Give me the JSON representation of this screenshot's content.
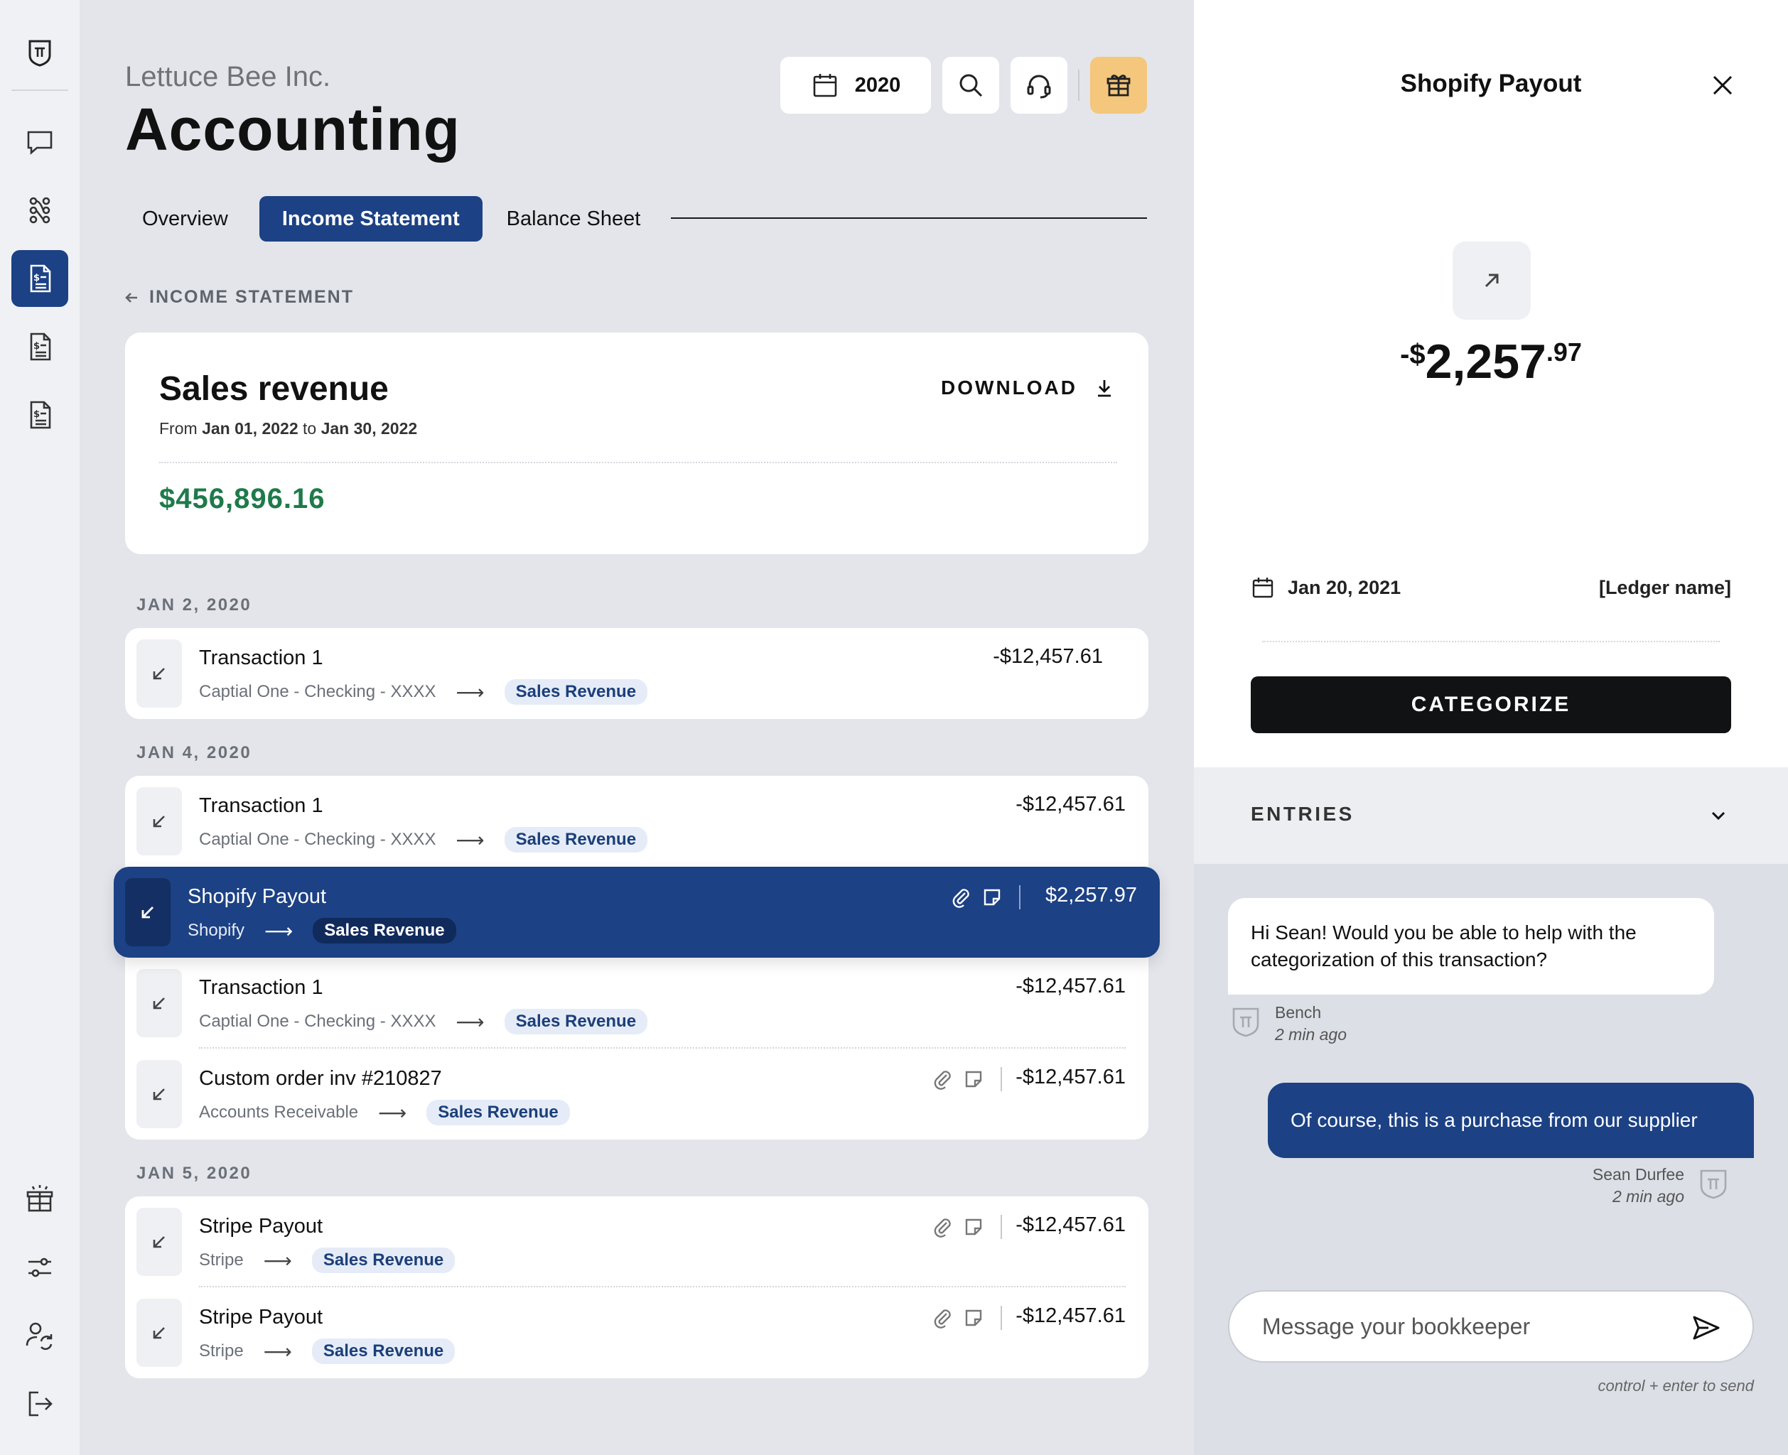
{
  "header": {
    "company": "Lettuce Bee Inc.",
    "title": "Accounting",
    "year": "2020"
  },
  "tabs": [
    {
      "label": "Overview",
      "active": false
    },
    {
      "label": "Income Statement",
      "active": true
    },
    {
      "label": "Balance Sheet",
      "active": false
    }
  ],
  "breadcrumb": "INCOME STATEMENT",
  "summary": {
    "title": "Sales revenue",
    "range_prefix": "From",
    "range_start": "Jan 01, 2022",
    "range_mid": "to",
    "range_end": "Jan 30, 2022",
    "download_label": "DOWNLOAD",
    "total": "$456,896.16"
  },
  "groups": [
    {
      "date": "JAN 2, 2020",
      "transactions": [
        {
          "name": "Transaction 1",
          "source": "Captial One - Checking - XXXX",
          "category": "Sales Revenue",
          "amount": "-$12,457.61"
        }
      ]
    },
    {
      "date": "JAN 4, 2020",
      "transactions": [
        {
          "name": "Transaction 1",
          "source": "Captial One - Checking - XXXX",
          "category": "Sales Revenue",
          "amount": "-$12,457.61"
        },
        {
          "name": "Shopify Payout",
          "source": "Shopify",
          "category": "Sales Revenue",
          "amount": "$2,257.97",
          "selected": true
        },
        {
          "name": "Transaction 1",
          "source": "Captial One - Checking - XXXX",
          "category": "Sales Revenue",
          "amount": "-$12,457.61"
        },
        {
          "name": "Custom order inv #210827",
          "source": "Accounts Receivable",
          "category": "Sales Revenue",
          "amount": "-$12,457.61"
        }
      ]
    },
    {
      "date": "JAN 5, 2020",
      "transactions": [
        {
          "name": "Stripe Payout",
          "source": "Stripe",
          "category": "Sales Revenue",
          "amount": "-$12,457.61"
        },
        {
          "name": "Stripe Payout",
          "source": "Stripe",
          "category": "Sales Revenue",
          "amount": "-$12,457.61"
        }
      ]
    }
  ],
  "panel": {
    "title": "Shopify Payout",
    "amount_sign": "-$",
    "amount_main": "2,257",
    "amount_cents": ".97",
    "date": "Jan 20, 2021",
    "ledger": "[Ledger name]",
    "categorize_label": "CATEGORIZE",
    "entries_label": "ENTRIES"
  },
  "chat": {
    "incoming": {
      "text": "Hi Sean! Would you be able to help with the categorization of this transaction?",
      "sender": "Bench",
      "time": "2 min ago"
    },
    "outgoing": {
      "text": "Of course, this is a purchase from our supplier",
      "sender": "Sean Durfee",
      "time": "2 min ago"
    },
    "placeholder": "Message your bookkeeper",
    "hint": "control + enter to send"
  },
  "colors": {
    "accent": "#1c4184",
    "positive": "#1f7a4a",
    "gift": "#f4c77d"
  }
}
